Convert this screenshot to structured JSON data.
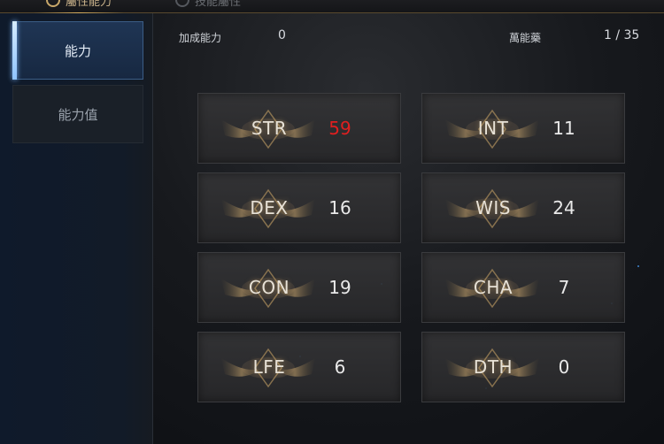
{
  "top_tabs": [
    {
      "label": "屬性能力",
      "state": "active"
    },
    {
      "label": "技能屬性",
      "state": "inactive"
    }
  ],
  "sidebar": {
    "items": [
      {
        "label": "能力",
        "active": true
      },
      {
        "label": "能力值",
        "active": false
      }
    ]
  },
  "header": {
    "bonus_label": "加成能力",
    "bonus_value": "0",
    "elixir_label": "萬能藥",
    "elixir_count": "1 / 35"
  },
  "stats": [
    {
      "name": "STR",
      "value": "59",
      "color": "#e01f1f"
    },
    {
      "name": "INT",
      "value": "11"
    },
    {
      "name": "DEX",
      "value": "16"
    },
    {
      "name": "WIS",
      "value": "24"
    },
    {
      "name": "CON",
      "value": "19"
    },
    {
      "name": "CHA",
      "value": "7"
    },
    {
      "name": "LFE",
      "value": "6"
    },
    {
      "name": "DTH",
      "value": "0"
    }
  ],
  "colors": {
    "accent_gold": "#d9b060",
    "highlight_red": "#e01f1f",
    "sidebar_active": "#1f3554"
  }
}
